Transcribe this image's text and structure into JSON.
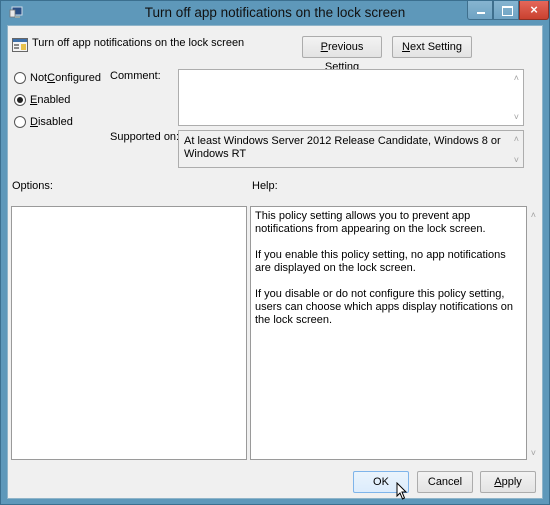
{
  "window": {
    "title": "Turn off app notifications on the lock screen",
    "controls": {
      "minimize": "minimize",
      "maximize": "maximize",
      "close": "×"
    }
  },
  "header": {
    "policy_name": "Turn off app notifications on the lock screen",
    "previous_setting": {
      "prefix": "",
      "mnemonic": "P",
      "rest": "revious Setting"
    },
    "next_setting": {
      "prefix": "",
      "mnemonic": "N",
      "rest": "ext Setting"
    }
  },
  "state": {
    "options": [
      {
        "prefix": "Not ",
        "mnemonic": "C",
        "rest": "onfigured",
        "checked": false
      },
      {
        "prefix": "",
        "mnemonic": "E",
        "rest": "nabled",
        "checked": true
      },
      {
        "prefix": "",
        "mnemonic": "D",
        "rest": "isabled",
        "checked": false
      }
    ]
  },
  "comment": {
    "label": "Comment:",
    "value": ""
  },
  "supported_on": {
    "label": "Supported on:",
    "value": "At least Windows Server 2012 Release Candidate, Windows 8 or Windows RT"
  },
  "options_panel": {
    "label": "Options:"
  },
  "help_panel": {
    "label": "Help:",
    "paragraphs": [
      "This policy setting allows you to prevent app notifications from appearing on the lock screen.",
      "If you enable this policy setting, no app notifications are displayed on the lock screen.",
      "If you disable or do not configure this policy setting, users can choose which apps display notifications on the lock screen."
    ]
  },
  "footer": {
    "ok": "OK",
    "cancel": "Cancel",
    "apply": {
      "mnemonic": "A",
      "rest": "pply"
    }
  }
}
